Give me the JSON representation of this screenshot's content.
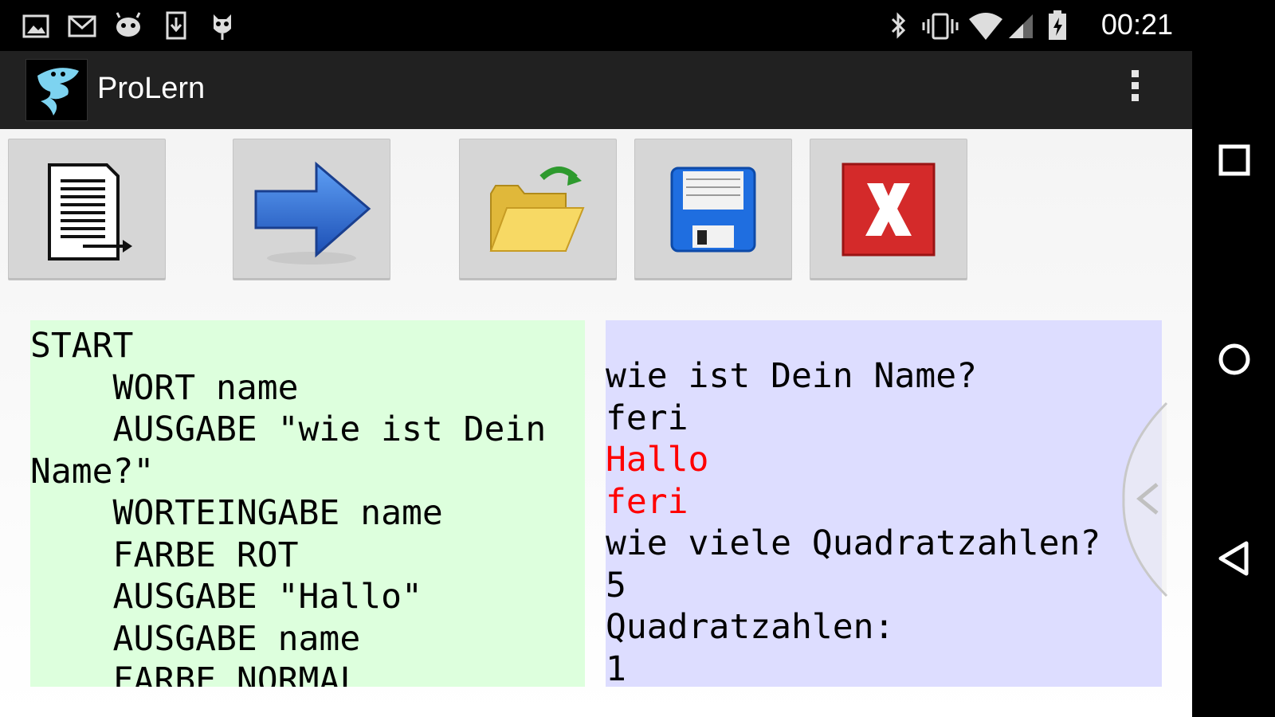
{
  "status_bar": {
    "time": "00:21",
    "left_icons": [
      "gallery-icon",
      "gmail-icon",
      "android-icon",
      "download-icon",
      "owl-icon"
    ],
    "right_icons": [
      "bluetooth-icon",
      "vibrate-icon",
      "wifi-icon",
      "signal-icon",
      "battery-icon"
    ]
  },
  "app": {
    "title": "ProLern"
  },
  "toolbar": {
    "buttons": [
      {
        "name": "new-document",
        "icon": "document-export-icon"
      },
      {
        "name": "run",
        "icon": "arrow-right-icon"
      },
      {
        "name": "open",
        "icon": "folder-open-icon"
      },
      {
        "name": "save",
        "icon": "floppy-disk-icon"
      },
      {
        "name": "close",
        "icon": "close-x-icon"
      }
    ]
  },
  "code_panel": {
    "lines": [
      "START",
      "    WORT name",
      "    AUSGABE \"wie ist Dein",
      "Name?\"",
      "    WORTEINGABE name",
      "    FARBE ROT",
      "    AUSGABE \"Hallo\"",
      "    AUSGABE name",
      "    FARBE NORMAL"
    ]
  },
  "output_panel": {
    "lines": [
      {
        "text": "wie ist Dein Name?",
        "color": "#000000"
      },
      {
        "text": "feri",
        "color": "#000000"
      },
      {
        "text": "Hallo",
        "color": "#ff0000"
      },
      {
        "text": "feri",
        "color": "#ff0000"
      },
      {
        "text": "wie viele Quadratzahlen?",
        "color": "#000000"
      },
      {
        "text": "5",
        "color": "#000000"
      },
      {
        "text": "Quadratzahlen:",
        "color": "#000000"
      },
      {
        "text": "1",
        "color": "#000000"
      }
    ]
  },
  "colors": {
    "code_bg": "#ddffdd",
    "output_bg": "#ddddff",
    "action_bar": "#212121"
  }
}
